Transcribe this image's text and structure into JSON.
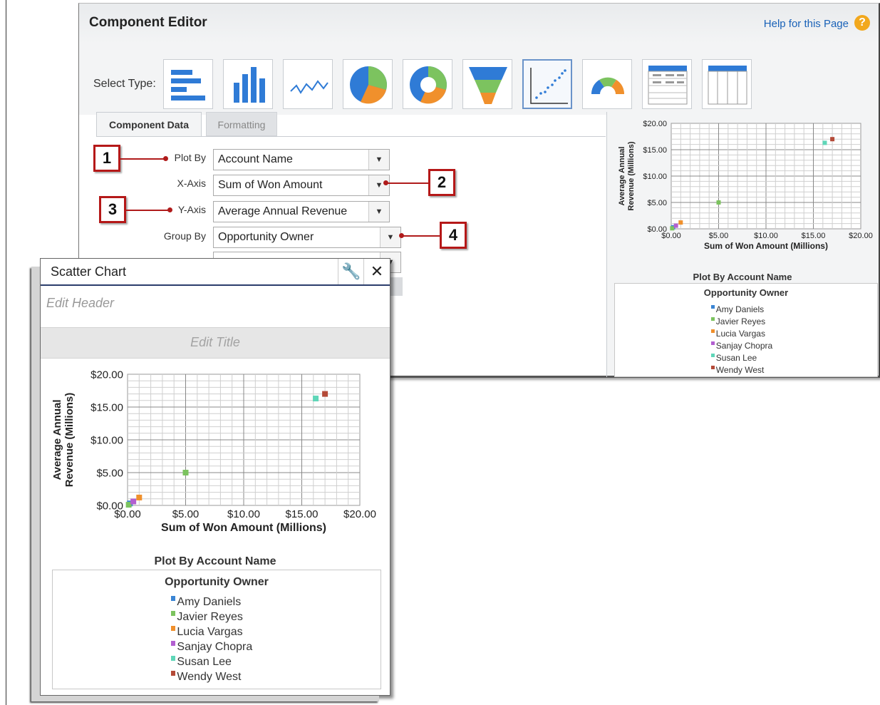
{
  "editor": {
    "title": "Component Editor",
    "help_link": "Help for this Page",
    "help_icon": "?",
    "select_type_label": "Select Type:",
    "chart_types": [
      {
        "name": "horizontal-bar-icon",
        "selected": false
      },
      {
        "name": "vertical-bar-icon",
        "selected": false
      },
      {
        "name": "line-icon",
        "selected": false
      },
      {
        "name": "pie-icon",
        "selected": false
      },
      {
        "name": "donut-icon",
        "selected": false
      },
      {
        "name": "funnel-icon",
        "selected": false
      },
      {
        "name": "scatter-icon",
        "selected": true
      },
      {
        "name": "gauge-icon",
        "selected": false
      },
      {
        "name": "table-icon",
        "selected": false
      },
      {
        "name": "lightning-table-icon",
        "selected": false
      }
    ],
    "tabs": [
      {
        "label": "Component Data",
        "active": true
      },
      {
        "label": "Formatting",
        "active": false
      }
    ],
    "fields": {
      "plot_by": {
        "label": "Plot By",
        "value": "Account Name"
      },
      "x_axis": {
        "label": "X-Axis",
        "value": "Sum of Won Amount"
      },
      "y_axis": {
        "label": "Y-Axis",
        "value": "Average Annual Revenue"
      },
      "group_by": {
        "label": "Group By",
        "value": "Opportunity Owner"
      }
    },
    "callouts": [
      "1",
      "2",
      "3",
      "4"
    ],
    "preview": {
      "plot_by_caption": "Plot By Account Name",
      "legend_title": "Opportunity Owner"
    }
  },
  "dialog": {
    "title": "Scatter Chart",
    "edit_header": "Edit Header",
    "edit_title": "Edit Title",
    "plot_by_caption": "Plot By Account Name",
    "legend_title": "Opportunity Owner"
  },
  "chart_data": {
    "type": "scatter",
    "xlabel": "Sum of Won Amount (Millions)",
    "ylabel": "Average Annual Revenue (Millions)",
    "ylabel_lines": [
      "Average Annual",
      "Revenue (Millions)"
    ],
    "xlim": [
      0,
      20
    ],
    "ylim": [
      0,
      20
    ],
    "x_ticks": [
      "$0.00",
      "$5.00",
      "$10.00",
      "$15.00",
      "$20.00"
    ],
    "y_ticks": [
      "$0.00",
      "$5.00",
      "$10.00",
      "$15.00",
      "$20.00"
    ],
    "grid": true,
    "legend_title": "Opportunity Owner",
    "series": [
      {
        "name": "Amy Daniels",
        "color": "#3a85d4",
        "points": [
          [
            0.2,
            0.3
          ]
        ]
      },
      {
        "name": "Javier Reyes",
        "color": "#7cc35f",
        "points": [
          [
            0.1,
            0.1
          ],
          [
            5.0,
            5.0
          ]
        ]
      },
      {
        "name": "Lucia Vargas",
        "color": "#f0902c",
        "points": [
          [
            1.0,
            1.2
          ]
        ]
      },
      {
        "name": "Sanjay Chopra",
        "color": "#b25fd0",
        "points": [
          [
            0.5,
            0.6
          ]
        ]
      },
      {
        "name": "Susan Lee",
        "color": "#5fd6b8",
        "points": [
          [
            16.2,
            16.3
          ]
        ]
      },
      {
        "name": "Wendy West",
        "color": "#b44a38",
        "points": [
          [
            17.0,
            17.0
          ]
        ]
      }
    ]
  }
}
